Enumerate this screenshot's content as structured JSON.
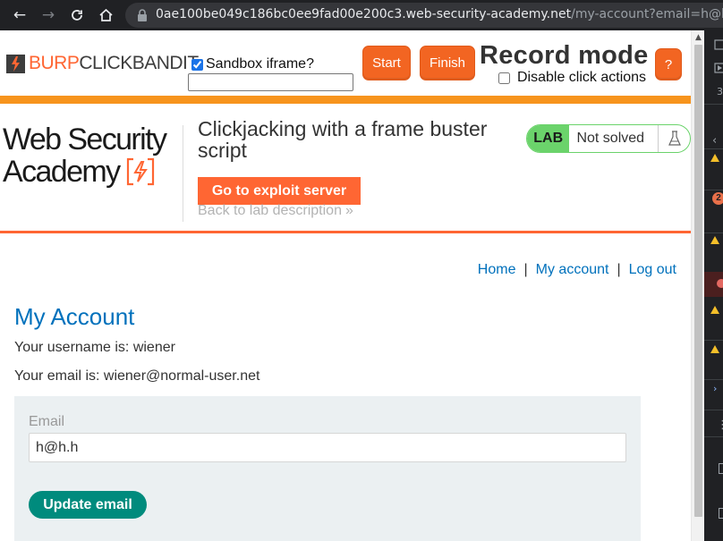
{
  "browser": {
    "url_host": "0ae100be049c186bc0ee9fad00e200c3.web-security-academy.net",
    "url_path": "/my-account?email=h@h.h"
  },
  "clickbandit": {
    "logo_burp": "BURP",
    "logo_clickbandit": "CLICKBANDIT",
    "sandbox_label": "Sandbox iframe?",
    "sandbox_checked": true,
    "sandbox_input_value": "",
    "start_label": "Start",
    "finish_label": "Finish",
    "record_mode_title": "Record mode",
    "disable_clicks_label": "Disable click actions",
    "disable_clicks_checked": false,
    "help_label": "?",
    "accent_color": "#f26522"
  },
  "lab": {
    "logo_line1": "Web Security",
    "logo_line2": "Academy",
    "title": "Clickjacking with a frame buster script",
    "exploit_button": "Go to exploit server",
    "back_link": "Back to lab description",
    "badge_lab": "LAB",
    "badge_status": "Not solved",
    "badge_icon": "flask-icon"
  },
  "nav": {
    "home": "Home",
    "separator": "|",
    "my_account": "My account",
    "log_out": "Log out"
  },
  "account": {
    "title": "My Account",
    "username_text": "Your username is: wiener",
    "email_text": "Your email is: wiener@normal-user.net",
    "email_label": "Email",
    "email_value": "h@h.h",
    "update_button": "Update email"
  },
  "devtools": {
    "counter_text": "3",
    "error_count": "2"
  }
}
